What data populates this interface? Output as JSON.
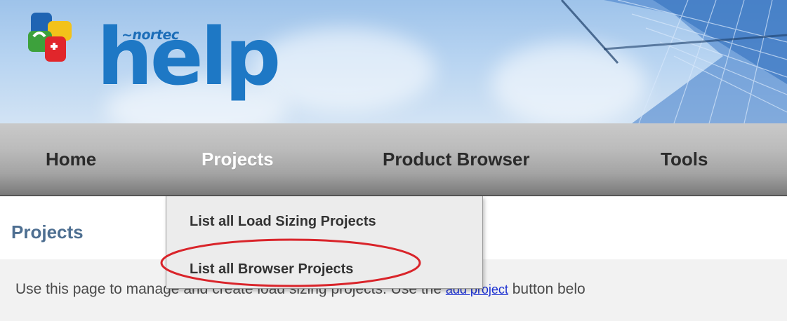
{
  "header": {
    "brand_small": "~nortec",
    "brand_big": "help"
  },
  "nav": {
    "items": [
      {
        "label": "Home"
      },
      {
        "label": "Projects"
      },
      {
        "label": "Product Browser"
      },
      {
        "label": "Tools"
      }
    ],
    "active": "Projects"
  },
  "dropdown": {
    "items": [
      {
        "label": "List all Load Sizing Projects"
      },
      {
        "label": "List all Browser Projects"
      }
    ],
    "highlighted": "List all Browser Projects",
    "highlight_color": "#d9242a"
  },
  "page": {
    "title": "Projects",
    "intro_before_link": "Use this page to manage and create load sizing projects. Use the ",
    "intro_link": "add project",
    "intro_after_link": " button belo"
  },
  "colors": {
    "brand_blue": "#1e78c5",
    "title_blue": "#4e6f91",
    "link_blue": "#1a2fd1",
    "nav_active_text": "#ffffff"
  },
  "icons": {
    "logo": "nortec-help-logo-blocks"
  }
}
